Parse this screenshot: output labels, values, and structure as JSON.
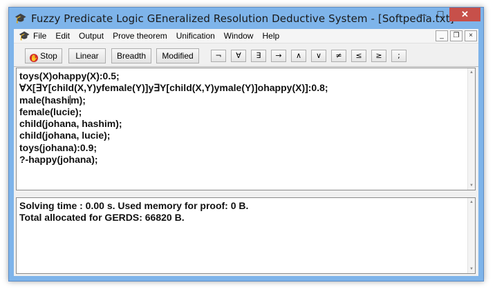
{
  "window": {
    "title": "Fuzzy Predicate Logic GEneralized Resolution Deductive System - [Softpedia.txt]",
    "controls": {
      "minimize": "—",
      "maximize": "☐",
      "close": "✕"
    }
  },
  "menu": {
    "items": [
      "File",
      "Edit",
      "Output",
      "Prove theorem",
      "Unification",
      "Window",
      "Help"
    ],
    "mdi": {
      "minimize": "_",
      "restore": "❐",
      "close": "×"
    }
  },
  "toolbar": {
    "buttons": [
      "Stop",
      "Linear",
      "Breadth",
      "Modified"
    ],
    "symbols": [
      "¬",
      "∀",
      "∃",
      "→",
      "∧",
      "∨",
      "≠",
      "≤",
      "≥",
      ";"
    ]
  },
  "editor": {
    "lines": [
      "toys(X)ohappy(X):0.5;",
      "∀X[∃Y[child(X,Y)yfemale(Y)]y∃Y[child(X,Y)ymale(Y)]ohappy(X)]:0.8;",
      "male(hashi",
      "m);",
      "female(lucie);",
      "child(johana, hashim);",
      "child(johana, lucie);",
      "toys(johana):0.9;",
      "?-happy(johana);"
    ]
  },
  "output": {
    "lines": [
      "Solving time : 0.00 s. Used memory for proof: 0 B.",
      "Total allocated for GERDS: 66820 B."
    ]
  }
}
